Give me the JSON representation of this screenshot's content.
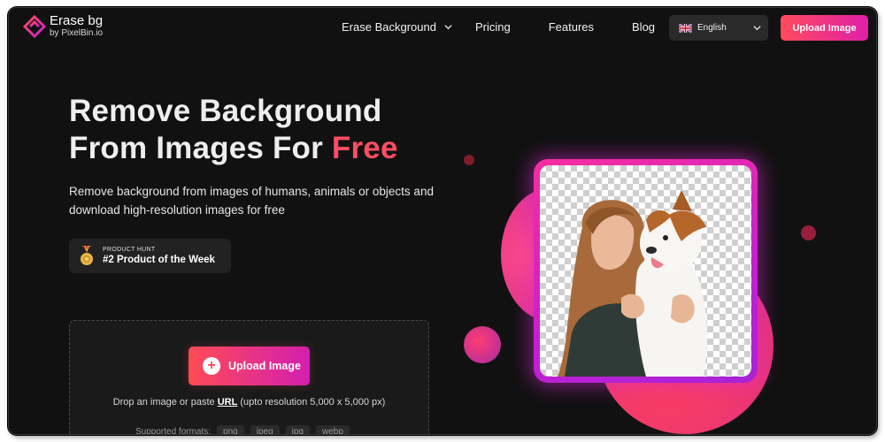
{
  "brand": {
    "title": "Erase bg",
    "subtitle": "by PixelBin.io",
    "logo_icon": "erase-bg-logo-icon",
    "accent": "#ff4d63",
    "accent_gradient_end": "#e01fa8"
  },
  "nav": {
    "items": [
      {
        "label": "Erase Background",
        "has_dropdown": true
      },
      {
        "label": "Pricing"
      },
      {
        "label": "Features"
      },
      {
        "label": "Blog"
      }
    ],
    "language": {
      "label": "English",
      "flag_icon": "uk-flag-icon"
    },
    "upload_label": "Upload Image"
  },
  "hero": {
    "title_line1": "Remove Background",
    "title_line2_prefix": "From Images For ",
    "title_highlight": "Free",
    "subtitle": "Remove background from images of humans, animals or objects and download high-resolution images for free"
  },
  "badge": {
    "kicker": "PRODUCT HUNT",
    "title": "#2 Product of the Week",
    "icon": "medal-icon"
  },
  "dropzone": {
    "upload_label": "Upload Image",
    "hint_prefix": "Drop an image or paste ",
    "hint_link": "URL",
    "hint_suffix": " (upto resolution 5,000 x 5,000 px)",
    "formats_label": "Supported formats:",
    "formats": [
      "png",
      "jpeg",
      "jpg",
      "webp"
    ]
  },
  "colors": {
    "background": "#111111",
    "surface": "#222222",
    "text": "#eeeeee"
  }
}
